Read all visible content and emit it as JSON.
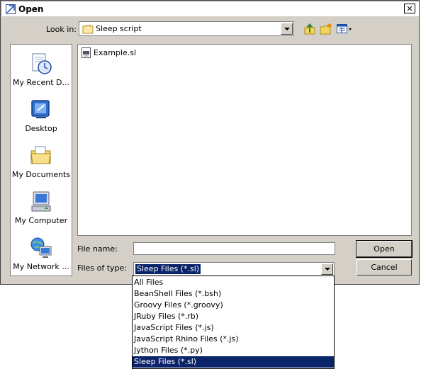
{
  "window": {
    "title": "Open",
    "close_label": "✕"
  },
  "look_in": {
    "label": "Look in:",
    "value": "Sleep script"
  },
  "toolbar": {
    "up_icon": "up-folder-icon",
    "new_folder_icon": "new-folder-icon",
    "view_icon": "view-menu-icon"
  },
  "places": [
    {
      "label": "My Recent D...",
      "icon": "recent-documents-icon"
    },
    {
      "label": "Desktop",
      "icon": "desktop-icon"
    },
    {
      "label": "My Documents",
      "icon": "my-documents-icon"
    },
    {
      "label": "My Computer",
      "icon": "my-computer-icon"
    },
    {
      "label": "My Network ...",
      "icon": "network-icon"
    }
  ],
  "files": [
    {
      "name": "Example.sl",
      "icon": "script-file-icon"
    }
  ],
  "file_name": {
    "label": "File name:",
    "value": ""
  },
  "file_type": {
    "label": "Files of type:",
    "selected": "Sleep Files (*.sl)",
    "options": [
      "All Files",
      "BeanShell Files (*.bsh)",
      "Groovy Files (*.groovy)",
      "JRuby Files (*.rb)",
      "JavaScript Files (*.js)",
      "JavaScript Rhino Files (*.js)",
      "Jython Files (*.py)",
      "Sleep Files (*.sl)"
    ],
    "selected_index": 7
  },
  "buttons": {
    "open": "Open",
    "cancel": "Cancel"
  },
  "colors": {
    "dialog_bg": "#d4d0c8",
    "selection": "#0a246a"
  }
}
